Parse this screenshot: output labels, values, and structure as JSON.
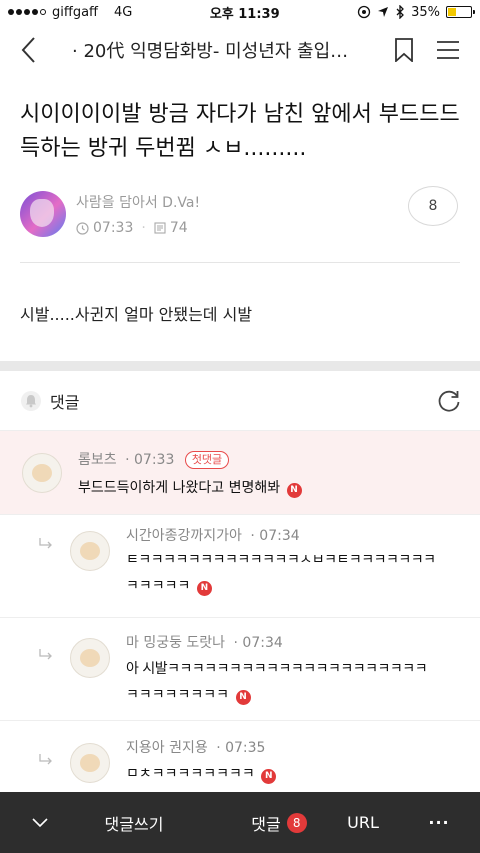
{
  "status_bar": {
    "carrier": "giffgaff",
    "network": "4G",
    "time": "오후 11:39",
    "battery": "35%",
    "battery_level": 0.35
  },
  "nav": {
    "title": "· 20代 익명담화방- 미성년자 출입…"
  },
  "post": {
    "title": "시이이이이발 방금 자다가 남친 앞에서 부드드드 득하는 방귀 두번뀜 ㅅㅂ.........",
    "author": "사람을 담아서 D.Va!",
    "time": "07:33",
    "views": "74",
    "comment_count": "8",
    "body": "시발.....사귄지 얼마 안됐는데 시발"
  },
  "comments_section": {
    "label": "댓글"
  },
  "comments": [
    {
      "name": "롬보츠",
      "time": "07:33",
      "badge": "첫댓글",
      "text": "부드드득이하게 나왔다고 변명해봐",
      "new_badge": "N"
    },
    {
      "name": "시간아종강까지가아",
      "time": "07:34",
      "line1": "ㅌㅋㅋㅋㅋㅋㅋㅋㅋㅋㅋㅋㅋㅋㅅㅂㅋㅌㅋㅋㅋㅋㅋㅋㅋ",
      "line2": "ㅋㅋㅋㅋㅋ",
      "new_badge": "N"
    },
    {
      "name": "마 밍궁둥 도랏나",
      "time": "07:34",
      "line1": "아 시발ㅋㅋㅋㅋㅋㅋㅋㅋㅋㅋㅋㅋㅋㅋㅋㅋㅋㅋㅋㅋㅋ",
      "line2": "ㅋㅋㅋㅋㅋㅋㅋㅋ",
      "new_badge": "N"
    },
    {
      "name": "지용아 권지용",
      "time": "07:35",
      "line1": "ㅁㅊㅋㅋㅋㅋㅋㅋㅋㅋ",
      "new_badge": "N"
    }
  ],
  "bottom_bar": {
    "write_comment": "댓글쓰기",
    "comments": "댓글",
    "comments_count": "8",
    "url": "URL",
    "more": "···"
  },
  "colors": {
    "accent_red": "#e23a3a",
    "highlight_bg": "#fcf0f0",
    "bottom_bar": "#2d2d2d",
    "battery_fill": "#f3c800"
  },
  "icons": [
    "signal-dots-icon",
    "location-icon",
    "bluetooth-icon",
    "battery-icon",
    "back-chevron-icon",
    "bookmark-icon",
    "menu-icon",
    "clock-icon",
    "views-icon",
    "bell-icon",
    "refresh-icon",
    "reply-arrow-icon",
    "chevron-down-icon"
  ]
}
